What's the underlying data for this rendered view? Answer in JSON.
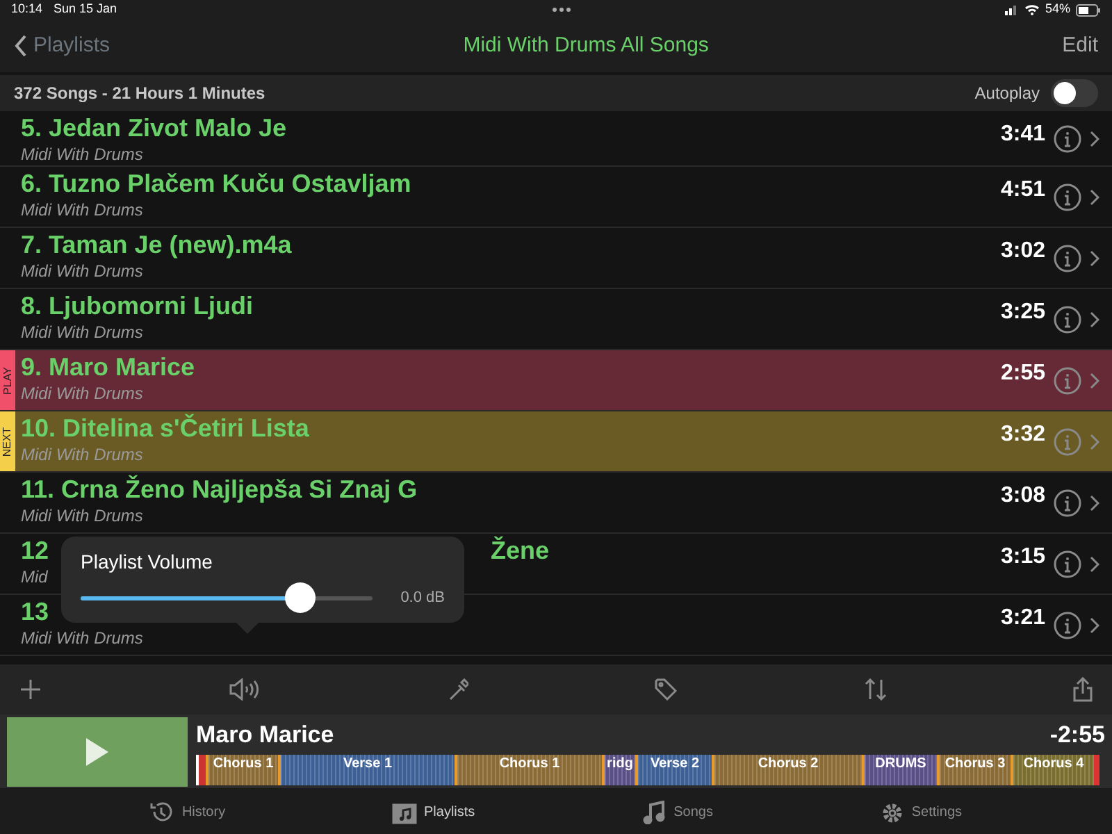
{
  "status_bar": {
    "time": "10:14",
    "date": "Sun 15 Jan",
    "battery": "54%"
  },
  "nav": {
    "back": "Playlists",
    "title": "Midi With Drums All Songs",
    "edit": "Edit"
  },
  "summary": {
    "text": "372 Songs - 21 Hours 1 Minutes",
    "autoplay_label": "Autoplay",
    "autoplay_on": false
  },
  "songs": [
    {
      "title": "5. Jedan Zivot Malo Je",
      "artist": "Midi With Drums",
      "duration": "3:41",
      "kind": "normal"
    },
    {
      "title": "6. Tuzno Plačem Kuču Ostavljam",
      "artist": "Midi With Drums",
      "duration": "4:51",
      "kind": "normal"
    },
    {
      "title": "7. Taman Je (new).m4a",
      "artist": "Midi With Drums",
      "duration": "3:02",
      "kind": "normal"
    },
    {
      "title": "8. Ljubomorni Ljudi",
      "artist": "Midi With Drums",
      "duration": "3:25",
      "kind": "normal"
    },
    {
      "title": "9. Maro Marice",
      "artist": "Midi With Drums",
      "duration": "2:55",
      "kind": "playing",
      "marker": "PLAY"
    },
    {
      "title": "10. Ditelina s'Četiri Lista",
      "artist": "Midi With Drums",
      "duration": "3:32",
      "kind": "next",
      "marker": "NEXT"
    },
    {
      "title": "11. Crna Ženo Najljepša Si Znaj G",
      "artist": "Midi With Drums",
      "duration": "3:08",
      "kind": "normal"
    },
    {
      "title": "12",
      "title_end": "Žene",
      "artist": "Mid",
      "duration": "3:15",
      "kind": "normal"
    },
    {
      "title": "13",
      "artist": "Midi With Drums",
      "duration": "3:21",
      "kind": "normal"
    }
  ],
  "volume_popover": {
    "title": "Playlist Volume",
    "level": 0.78,
    "reading": "0.0 dB"
  },
  "now_playing": {
    "title": "Maro Marice",
    "remaining": "-2:55",
    "sections": [
      {
        "label": "Chorus 1",
        "color": "#8a6a35"
      },
      {
        "label": "Verse 1",
        "color": "#3c5f96"
      },
      {
        "label": "Chorus 1",
        "color": "#8a6a35"
      },
      {
        "label": "ridg",
        "color": "#5a4f86"
      },
      {
        "label": "Verse 2",
        "color": "#3c5f96"
      },
      {
        "label": "Chorus 2",
        "color": "#8a6a35"
      },
      {
        "label": "DRUMS",
        "color": "#5a4f86"
      },
      {
        "label": "Chorus 3",
        "color": "#8a6a35"
      },
      {
        "label": "Chorus 4",
        "color": "#7a6e2e"
      }
    ]
  },
  "tab_bar": [
    {
      "label": "History",
      "selected": false
    },
    {
      "label": "Playlists",
      "selected": true
    },
    {
      "label": "Songs",
      "selected": false
    },
    {
      "label": "Settings",
      "selected": false
    }
  ]
}
